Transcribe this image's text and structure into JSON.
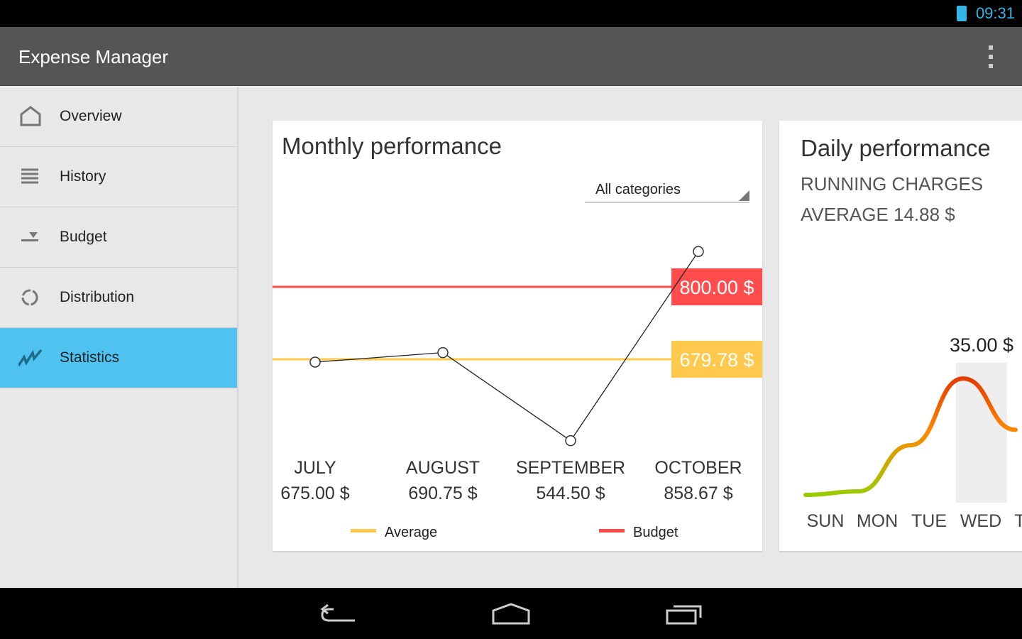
{
  "status": {
    "time": "09:31",
    "battery_icon": "battery-icon"
  },
  "app": {
    "title": "Expense Manager",
    "menu_icon": "overflow-menu-icon"
  },
  "sidebar": {
    "items": [
      {
        "label": "Overview",
        "icon": "home-icon"
      },
      {
        "label": "History",
        "icon": "list-icon"
      },
      {
        "label": "Budget",
        "icon": "budget-icon"
      },
      {
        "label": "Distribution",
        "icon": "donut-icon"
      },
      {
        "label": "Statistics",
        "icon": "chart-line-icon",
        "active": true
      }
    ],
    "active_color": "#4fc3ef"
  },
  "monthly": {
    "title": "Monthly performance",
    "filter": "All categories",
    "budget_label": "800.00 $",
    "average_label": "679.78 $",
    "legend": {
      "average": "Average",
      "budget": "Budget"
    },
    "colors": {
      "average": "#ffc94d",
      "budget": "#ff4d4d"
    }
  },
  "daily": {
    "title": "Daily performance",
    "subtitle1": "RUNNING CHARGES",
    "subtitle2": "AVERAGE 14.88 $",
    "peak_label": "35.00 $"
  },
  "chart_data": [
    {
      "type": "line",
      "title": "Monthly performance",
      "categories": [
        "JULY",
        "AUGUST",
        "SEPTEMBER",
        "OCTOBER"
      ],
      "value_labels": [
        "675.00 $",
        "690.75 $",
        "544.50 $",
        "858.67 $"
      ],
      "values": [
        675.0,
        690.75,
        544.5,
        858.67
      ],
      "reference_lines": [
        {
          "name": "Budget",
          "value": 800.0
        },
        {
          "name": "Average",
          "value": 679.78
        }
      ],
      "legend": "bottom"
    },
    {
      "type": "line",
      "title": "Daily performance",
      "categories": [
        "SUN",
        "MON",
        "TUE",
        "WED",
        "THU"
      ],
      "values": [
        1,
        2,
        15.5,
        35,
        20
      ],
      "highlight": "WED",
      "ylim": [
        0,
        35
      ]
    }
  ]
}
